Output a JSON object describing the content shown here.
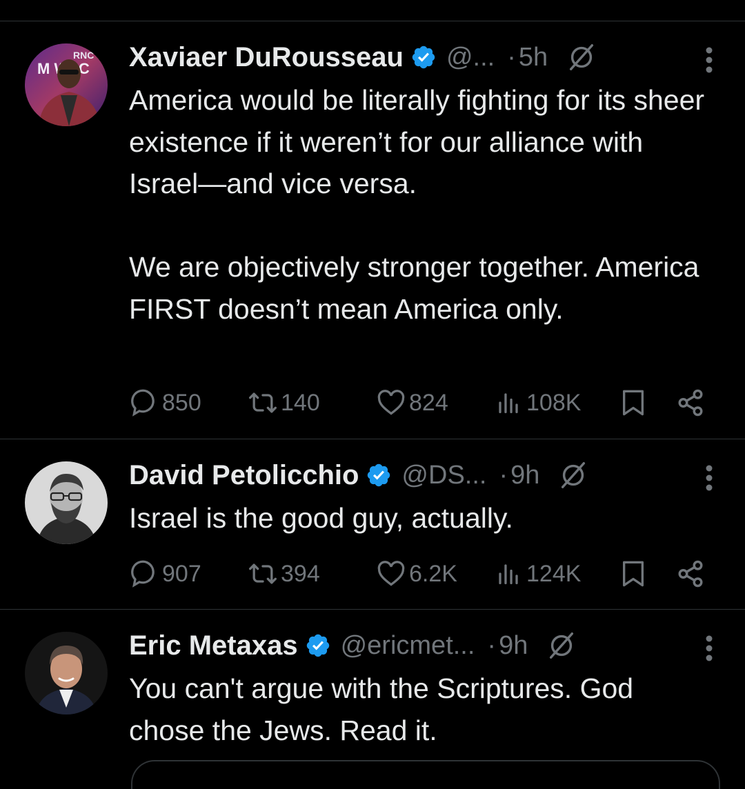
{
  "colors": {
    "background": "#000000",
    "text": "#e7e9ea",
    "muted": "#71767b",
    "verified": "#1d9bf0",
    "divider": "#2f3336"
  },
  "tweets": [
    {
      "name": "Xaviaer DuRousseau",
      "handle": "@...",
      "time": "5h",
      "text": "America would be literally fighting for its sheer existence if it weren’t for our alliance with Israel—and vice versa.\n\nWe are objectively stronger together. America FIRST doesn’t mean America only.",
      "avatar_text": {
        "top": "RNC",
        "mid": "M WAC"
      },
      "stats": {
        "replies": "850",
        "reposts": "140",
        "likes": "824",
        "views": "108K"
      }
    },
    {
      "name": "David Petolicchio",
      "handle": "@DS...",
      "time": "9h",
      "text": "Israel is the good guy, actually.",
      "stats": {
        "replies": "907",
        "reposts": "394",
        "likes": "6.2K",
        "views": "124K"
      }
    },
    {
      "name": "Eric Metaxas",
      "handle": "@ericmet...",
      "time": "9h",
      "text": "You can't argue with the Scriptures. God chose the Jews. Read it."
    }
  ],
  "separator": "·",
  "icons": [
    "verified-badge-icon",
    "grok-icon",
    "more-icon",
    "reply-icon",
    "repost-icon",
    "like-icon",
    "views-icon",
    "bookmark-icon",
    "share-icon"
  ]
}
